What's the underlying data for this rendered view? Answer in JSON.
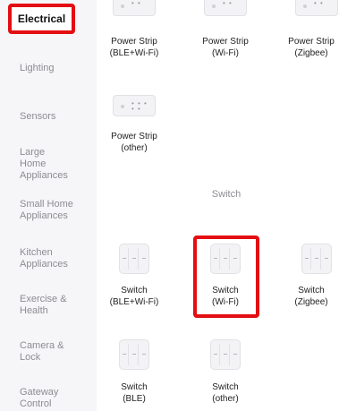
{
  "sidebar": {
    "items": [
      {
        "label": "Electrical"
      },
      {
        "label": "Lighting"
      },
      {
        "label": "Sensors"
      },
      {
        "label": "Large Home Appliances"
      },
      {
        "label": "Small Home Appliances"
      },
      {
        "label": "Kitchen Appliances"
      },
      {
        "label": "Exercise & Health"
      },
      {
        "label": "Camera & Lock"
      },
      {
        "label": "Gateway Control"
      }
    ]
  },
  "power_strips": [
    {
      "line1": "Power Strip",
      "line2": "(BLE+Wi-Fi)"
    },
    {
      "line1": "Power Strip",
      "line2": "(Wi-Fi)"
    },
    {
      "line1": "Power Strip",
      "line2": "(Zigbee)"
    },
    {
      "line1": "Power Strip",
      "line2": "(other)"
    }
  ],
  "switch_section": {
    "title": "Switch"
  },
  "switches": [
    {
      "line1": "Switch",
      "line2": "(BLE+Wi-Fi)"
    },
    {
      "line1": "Switch",
      "line2": "(Wi-Fi)"
    },
    {
      "line1": "Switch",
      "line2": "(Zigbee)"
    },
    {
      "line1": "Switch",
      "line2": "(BLE)"
    },
    {
      "line1": "Switch",
      "line2": "(other)"
    }
  ],
  "colors": {
    "highlight": "#e30d12",
    "sidebar_bg": "#f6f6f8"
  },
  "icons": {
    "power_strip": "power-strip-icon",
    "switch": "wall-switch-icon"
  }
}
